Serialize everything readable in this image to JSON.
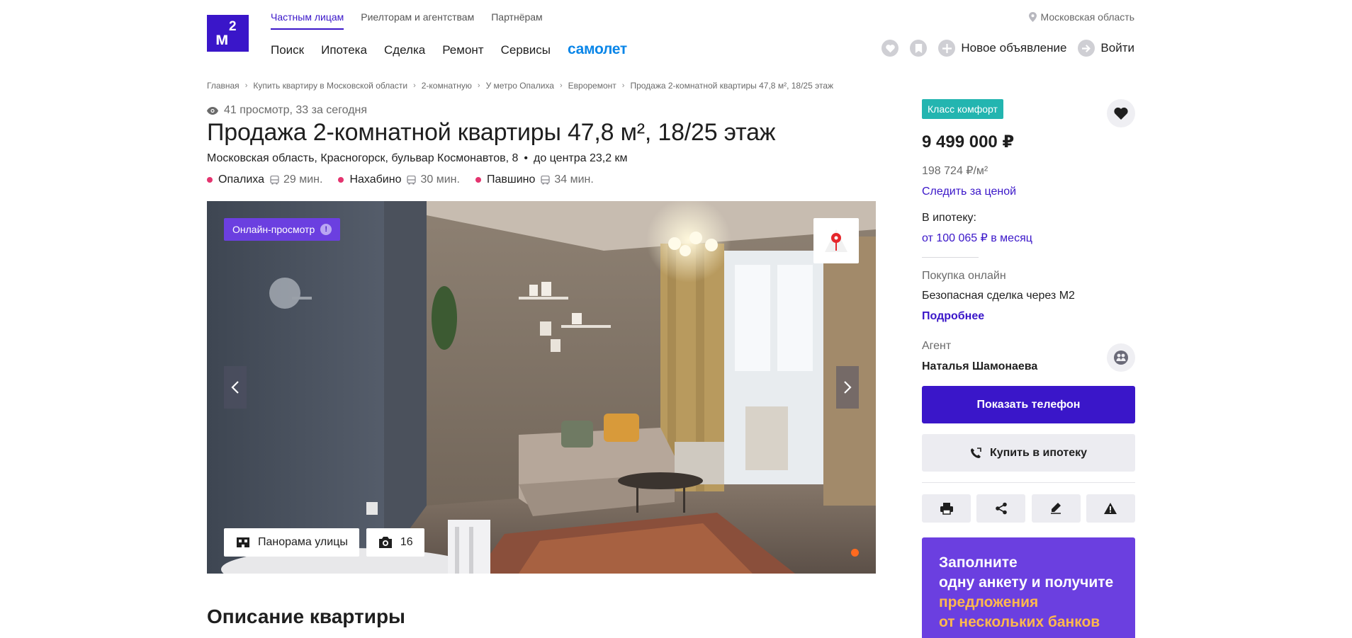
{
  "header": {
    "logo_text": "м",
    "logo_sup": "2",
    "audience_tabs": [
      {
        "label": "Частным лицам",
        "active": true
      },
      {
        "label": "Риелторам и агентствам",
        "active": false
      },
      {
        "label": "Партнёрам",
        "active": false
      }
    ],
    "region": "Московская область",
    "nav": [
      "Поиск",
      "Ипотека",
      "Сделка",
      "Ремонт",
      "Сервисы"
    ],
    "partner": "самолет",
    "new_ad": "Новое объявление",
    "login": "Войти"
  },
  "breadcrumb": [
    "Главная",
    "Купить квартиру в Московской области",
    "2-комнатную",
    "У метро Опалиха",
    "Евроремонт",
    "Продажа 2-комнатной квартиры 47,8 м², 18/25 этаж"
  ],
  "listing": {
    "views": "41 просмотр, 33 за сегодня",
    "title": "Продажа 2-комнатной квартиры 47,8 м², 18/25 этаж",
    "address": [
      "Московская область,",
      "Красногорск,",
      "бульвар Космонавтов,",
      "8"
    ],
    "address_dot": "•",
    "distance": "до центра 23,2 км",
    "metros": [
      {
        "name": "Опалиха",
        "time": "29 мин."
      },
      {
        "name": "Нахабино",
        "time": "30 мин."
      },
      {
        "name": "Павшино",
        "time": "34 мин."
      }
    ]
  },
  "gallery": {
    "online_badge": "Онлайн-просмотр",
    "info_mark": "!",
    "panorama_label": "Панорама улицы",
    "photo_count": "16"
  },
  "description_title": "Описание квартиры",
  "sidebar": {
    "class_badge": "Класс комфорт",
    "price": "9 499 000 ₽",
    "price_per_m2": "198 724 ₽/м²",
    "watch_price": "Следить за ценой",
    "mortgage_label": "В ипотеку:",
    "mortgage_value": "от 100 065 ₽ в месяц",
    "buy_online_label": "Покупка онлайн",
    "safe_deal": "Безопасная сделка через М2",
    "more_link": "Подробнее",
    "agent_label": "Агент",
    "agent_name": "Наталья Шамонаева",
    "show_phone": "Показать телефон",
    "buy_mortgage": "Купить в ипотеку",
    "promo_lines": [
      "Заполните",
      "одну анкету и получите",
      "предложения",
      "от нескольких банков"
    ]
  },
  "colors": {
    "brand": "#3a16c9",
    "promo": "#6b3fe0",
    "badge": "#23b5b0",
    "metro_dot": "#e4346f",
    "samolet": "#0a86e8"
  },
  "icons": {
    "region": "location-pin-icon",
    "views": "eye-icon",
    "metro_transport": "bus-icon",
    "tools": [
      "print-icon",
      "share-icon",
      "edit-icon",
      "warning-icon"
    ]
  }
}
